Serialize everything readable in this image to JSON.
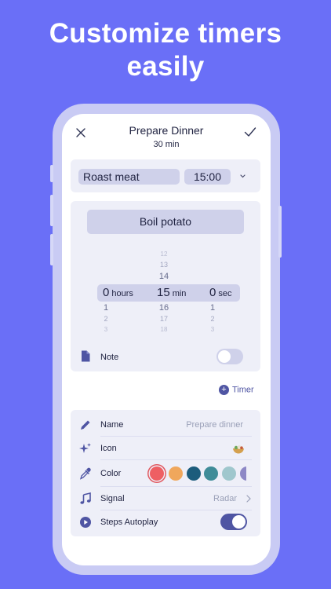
{
  "headline": {
    "line1": "Customize timers",
    "line2": "easily"
  },
  "header": {
    "title": "Prepare Dinner",
    "duration": "30 min"
  },
  "steps": [
    {
      "name": "Roast meat",
      "time": "15:00"
    },
    {
      "name": "Boil potato"
    }
  ],
  "picker": {
    "hours": {
      "above": [],
      "selected": "0",
      "below": [
        "1",
        "2",
        "3"
      ],
      "unit": "hours"
    },
    "minutes": {
      "above": [
        "12",
        "13",
        "14"
      ],
      "selected": "15",
      "below": [
        "16",
        "17",
        "18"
      ],
      "unit": "min"
    },
    "seconds": {
      "above": [],
      "selected": "0",
      "below": [
        "1",
        "2",
        "3"
      ],
      "unit": "sec"
    }
  },
  "note": {
    "label": "Note",
    "enabled": false
  },
  "add_timer": {
    "label": "Timer"
  },
  "settings": {
    "name": {
      "label": "Name",
      "placeholder": "Prepare dinner"
    },
    "icon": {
      "label": "Icon",
      "value_icon": "food-bowl-icon"
    },
    "color": {
      "label": "Color",
      "options": [
        "#ee5f63",
        "#f0a75c",
        "#1c5c7c",
        "#3f8c98",
        "#9fc7cd",
        "#8d88c6"
      ],
      "selected": "#ee5f63"
    },
    "signal": {
      "label": "Signal",
      "value": "Radar"
    },
    "autoplay": {
      "label": "Steps Autoplay",
      "enabled": true
    }
  },
  "colors": {
    "background": "#6a6ff7",
    "accent": "#4f55a3",
    "card": "#eeeff8",
    "pill": "#cfd1ea"
  }
}
